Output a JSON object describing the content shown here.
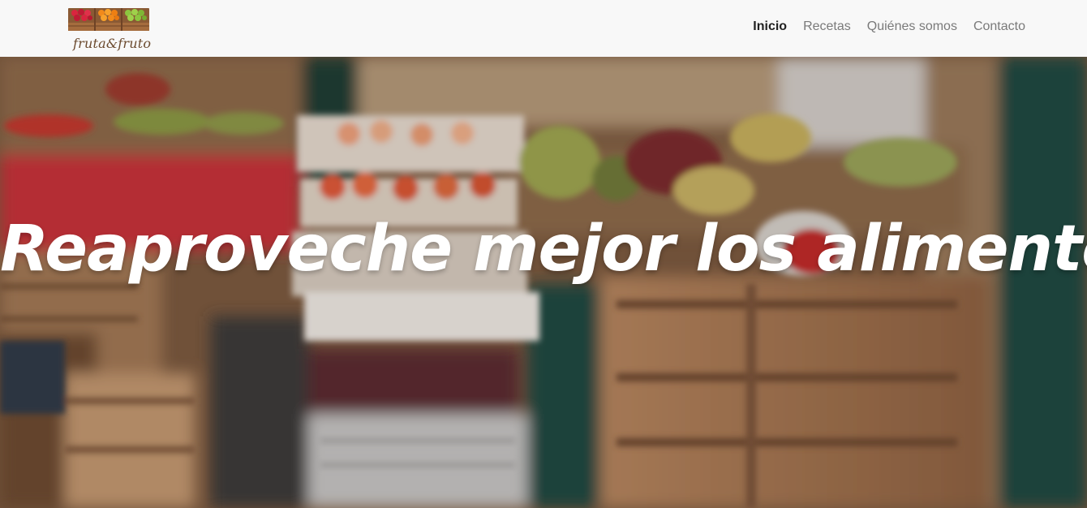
{
  "brand": {
    "logo_text": "fruta&fruto",
    "crate_colors": [
      "#d9253f",
      "#f28a1a",
      "#8cc63f"
    ]
  },
  "nav": {
    "items": [
      {
        "label": "Inicio",
        "active": true
      },
      {
        "label": "Recetas",
        "active": false
      },
      {
        "label": "Quiénes somos",
        "active": false
      },
      {
        "label": "Contacto",
        "active": false
      }
    ]
  },
  "hero": {
    "title": "Reaproveche mejor los alimentos"
  }
}
